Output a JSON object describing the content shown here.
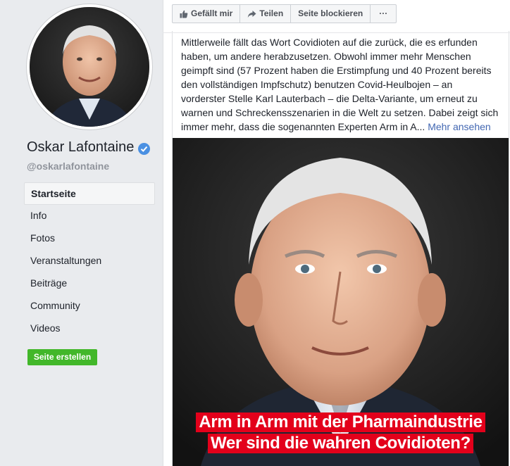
{
  "profile": {
    "name": "Oskar Lafontaine",
    "handle": "@oskarlafontaine"
  },
  "nav": [
    {
      "label": "Startseite",
      "active": true
    },
    {
      "label": "Info"
    },
    {
      "label": "Fotos"
    },
    {
      "label": "Veranstaltungen"
    },
    {
      "label": "Beiträge"
    },
    {
      "label": "Community"
    },
    {
      "label": "Videos"
    }
  ],
  "create_page_label": "Seite erstellen",
  "actions": {
    "like": "Gefällt mir",
    "share": "Teilen",
    "block": "Seite blockieren",
    "more": "···"
  },
  "post": {
    "text": "Mittlerweile fällt das Wort Covidioten auf die zurück, die es erfunden haben, um andere herabzusetzen. Obwohl immer mehr Menschen geimpft sind (57 Prozent haben die Erstimpfung und 40 Prozent bereits den vollständigen Impfschutz) benutzen Covid-Heulbojen – an vorderster Stelle Karl Lauterbach – die Delta-Variante, um erneut zu warnen und Schreckensszenarien in die Welt zu setzen. Dabei zeigt sich immer mehr, dass die sogenannten Experten Arm in A...",
    "more_label": "Mehr ansehen",
    "image_headline": [
      "Arm in Arm mit der Pharmaindustrie",
      "Wer sind die wahren Covidioten?"
    ]
  },
  "colors": {
    "verified": "#4a90e2",
    "create_button": "#42b72a",
    "link": "#4267b2",
    "headline_bg": "#e3001b"
  }
}
